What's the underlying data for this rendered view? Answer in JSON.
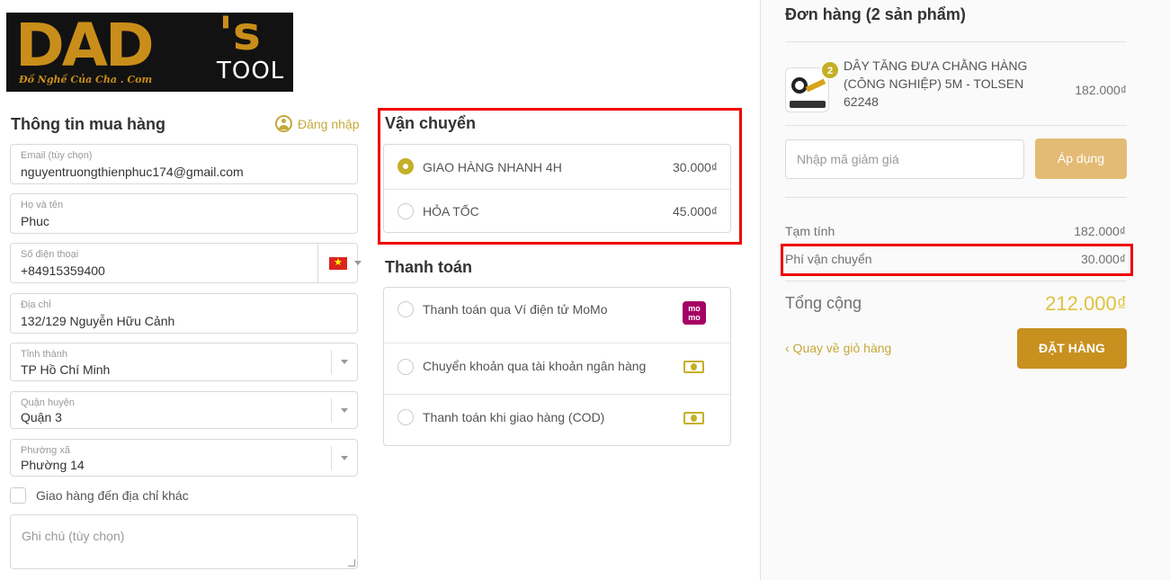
{
  "logo": {
    "main": "DAD",
    "apostrophe": "'s",
    "tool": "TOOL",
    "sub": "Đồ Nghề Của Cha . Com"
  },
  "buyer": {
    "title": "Thông tin mua hàng",
    "login_label": "Đăng nhập",
    "fields": {
      "email": {
        "label": "Email (tùy chọn)",
        "value": "nguyentruongthienphuc174@gmail.com"
      },
      "name": {
        "label": "Họ và tên",
        "value": "Phuc"
      },
      "phone": {
        "label": "Số điện thoại",
        "value": "+84915359400"
      },
      "address": {
        "label": "Địa chỉ",
        "value": "132/129 Nguyễn Hữu Cảnh"
      },
      "province": {
        "label": "Tỉnh thành",
        "value": "TP Hồ Chí Minh"
      },
      "district": {
        "label": "Quận huyện",
        "value": "Quận 3"
      },
      "ward": {
        "label": "Phường xã",
        "value": "Phường 14"
      }
    },
    "other_address_label": "Giao hàng đến địa chỉ khác",
    "note_placeholder": "Ghi chú (tùy chọn)"
  },
  "shipping": {
    "title": "Vận chuyển",
    "options": [
      {
        "label": "GIAO HÀNG NHANH 4H",
        "price": "30.000₫",
        "selected": true
      },
      {
        "label": "HỎA TỐC",
        "price": "45.000₫",
        "selected": false
      }
    ]
  },
  "payment": {
    "title": "Thanh toán",
    "options": [
      {
        "label": "Thanh toán qua Ví điện tử MoMo",
        "icon": "momo-icon",
        "icon_text": "mo mo"
      },
      {
        "label": "Chuyển khoản qua tài khoản ngân hàng",
        "icon": "money-icon"
      },
      {
        "label": "Thanh toán khi giao hàng (COD)",
        "icon": "money-icon"
      }
    ]
  },
  "order": {
    "title": "Đơn hàng (2 sản phẩm)",
    "product": {
      "qty": "2",
      "name": "DÂY TĂNG ĐƯA CHẰNG HÀNG (CÔNG NGHIỆP) 5M - TOLSEN 62248",
      "price": "182.000₫"
    },
    "coupon_placeholder": "Nhập mã giảm giá",
    "apply_label": "Áp dụng",
    "subtotal_label": "Tạm tính",
    "subtotal_value": "182.000₫",
    "shipping_fee_label": "Phí vận chuyển",
    "shipping_fee_value": "30.000₫",
    "total_label": "Tổng cộng",
    "total_value": "212.000₫",
    "back_label": "‹ Quay về giỏ hàng",
    "order_button": "ĐẶT HÀNG"
  },
  "colors": {
    "accent": "#c4b027",
    "order_button": "#c8901f",
    "apply_button": "#e3bb74",
    "highlight_box": "#ee0000",
    "logo_gold": "#c98e1a"
  }
}
